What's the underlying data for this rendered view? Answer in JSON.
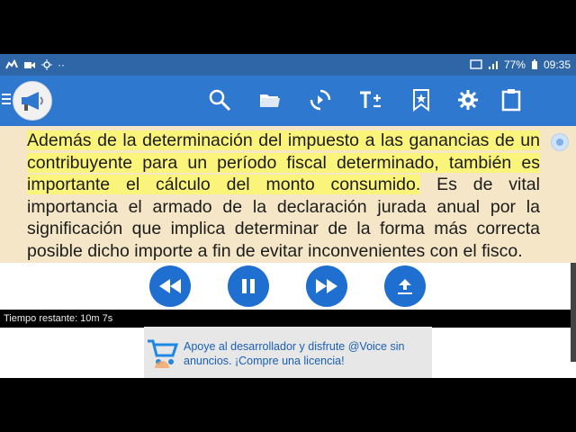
{
  "statusbar": {
    "left_icons": [
      "messenger-icon",
      "video-icon",
      "brightness-icon",
      "more-dots-icon"
    ],
    "more_dots": "··",
    "battery": "77%",
    "time": "09:35"
  },
  "appbar": {
    "icons": [
      "search-icon",
      "folder-icon",
      "sync-icon",
      "text-size-icon",
      "bookmark-star-icon",
      "settings-icon",
      "clipboard-icon"
    ]
  },
  "reader": {
    "highlighted": "Además de la determinación del impuesto a las ganancias de un contribuyente para un período fiscal determinado, también es importante el cálculo del monto consumido.",
    "rest": " Es de vital importancia el armado de la declaración jurada anual por la significación que implica determinar de la forma más correcta posible dicho importe a fin de evitar inconvenientes con el fisco."
  },
  "controls": {
    "icons": [
      "rewind-icon",
      "pause-icon",
      "fast-forward-icon",
      "upload-icon"
    ]
  },
  "timer": {
    "text": "Tiempo restante: 10m 7s"
  },
  "ad": {
    "text": "Apoye al desarrollador y disfrute @Voice sin anuncios. ¡Compre una licencia!"
  },
  "colors": {
    "statusbar": "#2f66a8",
    "appbar": "#2e78cf",
    "content_bg": "#f4e6c6",
    "highlight": "#fbf47a",
    "control": "#1e6fd0",
    "ad_text": "#1a5fb4"
  }
}
